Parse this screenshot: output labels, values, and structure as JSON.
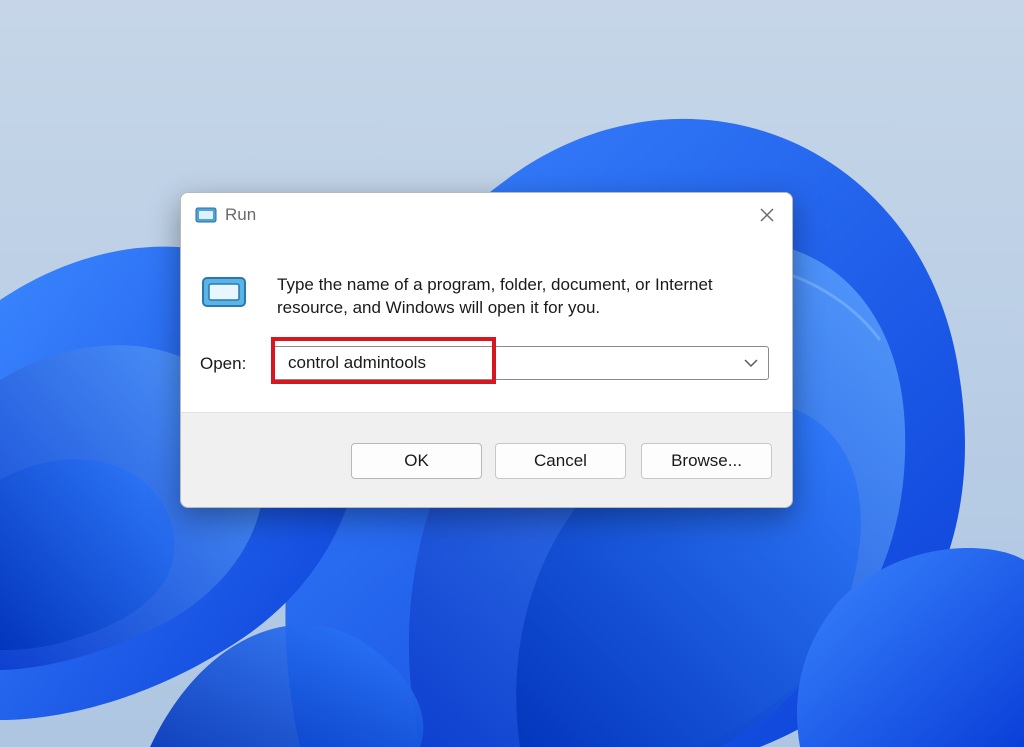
{
  "dialog": {
    "title": "Run",
    "description": "Type the name of a program, folder, document, or Internet resource, and Windows will open it for you.",
    "open_label": "Open:",
    "open_value": "control admintools",
    "buttons": {
      "ok": "OK",
      "cancel": "Cancel",
      "browse": "Browse..."
    }
  },
  "icons": {
    "title": "run-icon",
    "content": "run-icon",
    "close": "close-icon",
    "dropdown": "chevron-down-icon"
  },
  "colors": {
    "highlight": "#d7161d",
    "wallpaper_accent": "#1a5ff0",
    "wallpaper_background": "#b9cde3"
  }
}
